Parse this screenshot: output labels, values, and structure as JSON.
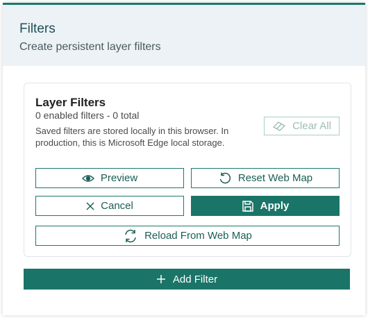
{
  "header": {
    "title": "Filters",
    "subtitle": "Create persistent layer filters"
  },
  "card": {
    "title": "Layer Filters",
    "count_text": "0 enabled filters - 0 total",
    "note": "Saved filters are stored locally in this browser. In production, this is Microsoft Edge local storage.",
    "clear_all_label": "Clear All"
  },
  "actions": {
    "preview_label": "Preview",
    "reset_label": "Reset Web Map",
    "cancel_label": "Cancel",
    "apply_label": "Apply",
    "reload_label": "Reload From Web Map"
  },
  "footer": {
    "add_filter_label": "Add Filter"
  },
  "colors": {
    "accent": "#1a7568",
    "header_bg": "#ecf2f5",
    "disabled_border": "#a8cfc6"
  },
  "icons": {
    "clear_all": "eraser-icon",
    "preview": "eye-icon",
    "reset": "refresh-ccw-icon",
    "cancel": "close-icon",
    "apply": "save-icon",
    "reload": "refresh-icon",
    "add": "plus-icon"
  }
}
